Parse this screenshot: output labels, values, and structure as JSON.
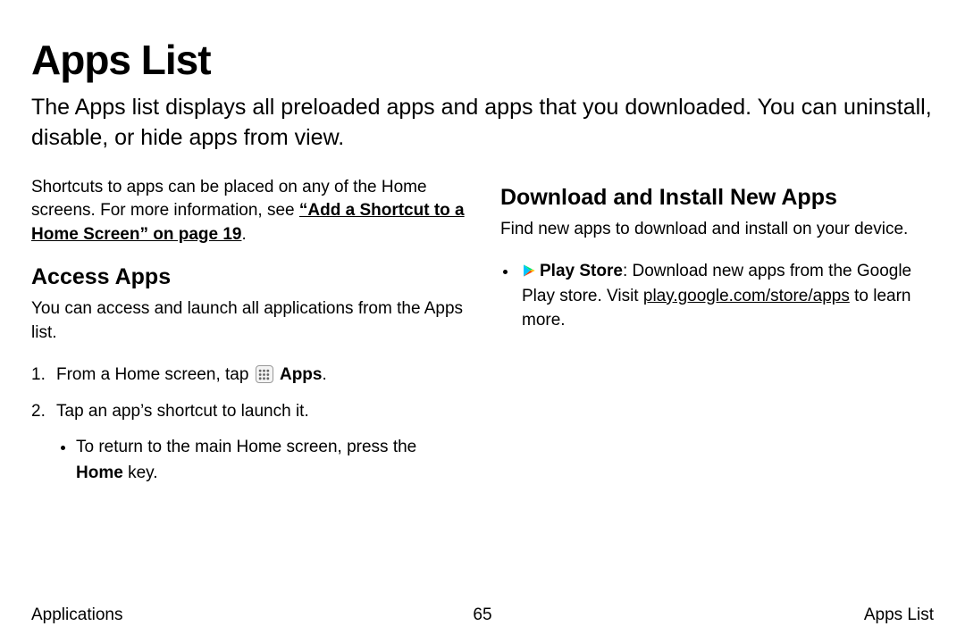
{
  "title": "Apps List",
  "intro": "The Apps list displays all preloaded apps and apps that you downloaded. You can uninstall, disable, or hide apps from view.",
  "left": {
    "shortcuts_prefix": "Shortcuts to apps can be placed on any of the Home screens. For more information, see ",
    "shortcuts_link": "“Add a Shortcut to a Home Screen” on page 19",
    "shortcuts_suffix": ".",
    "access_heading": "Access Apps",
    "access_intro": "You can access and launch all applications from the Apps list.",
    "step1_prefix": "From a Home screen, tap ",
    "step1_appslabel": "Apps",
    "step1_suffix": ".",
    "step2": "Tap an app’s shortcut to launch it.",
    "step2_sub_prefix": "To return to the main Home screen, press the ",
    "step2_sub_home": "Home",
    "step2_sub_suffix": " key."
  },
  "right": {
    "download_heading": "Download and Install New Apps",
    "download_intro": "Find new apps to download and install on your device.",
    "playstore_label": "Play Store",
    "playstore_text1": ": Download new apps from the Google Play store. Visit ",
    "playstore_link": "play.google.com/store/apps",
    "playstore_text2": " to learn more."
  },
  "footer": {
    "left": "Applications",
    "center": "65",
    "right": "Apps List"
  }
}
